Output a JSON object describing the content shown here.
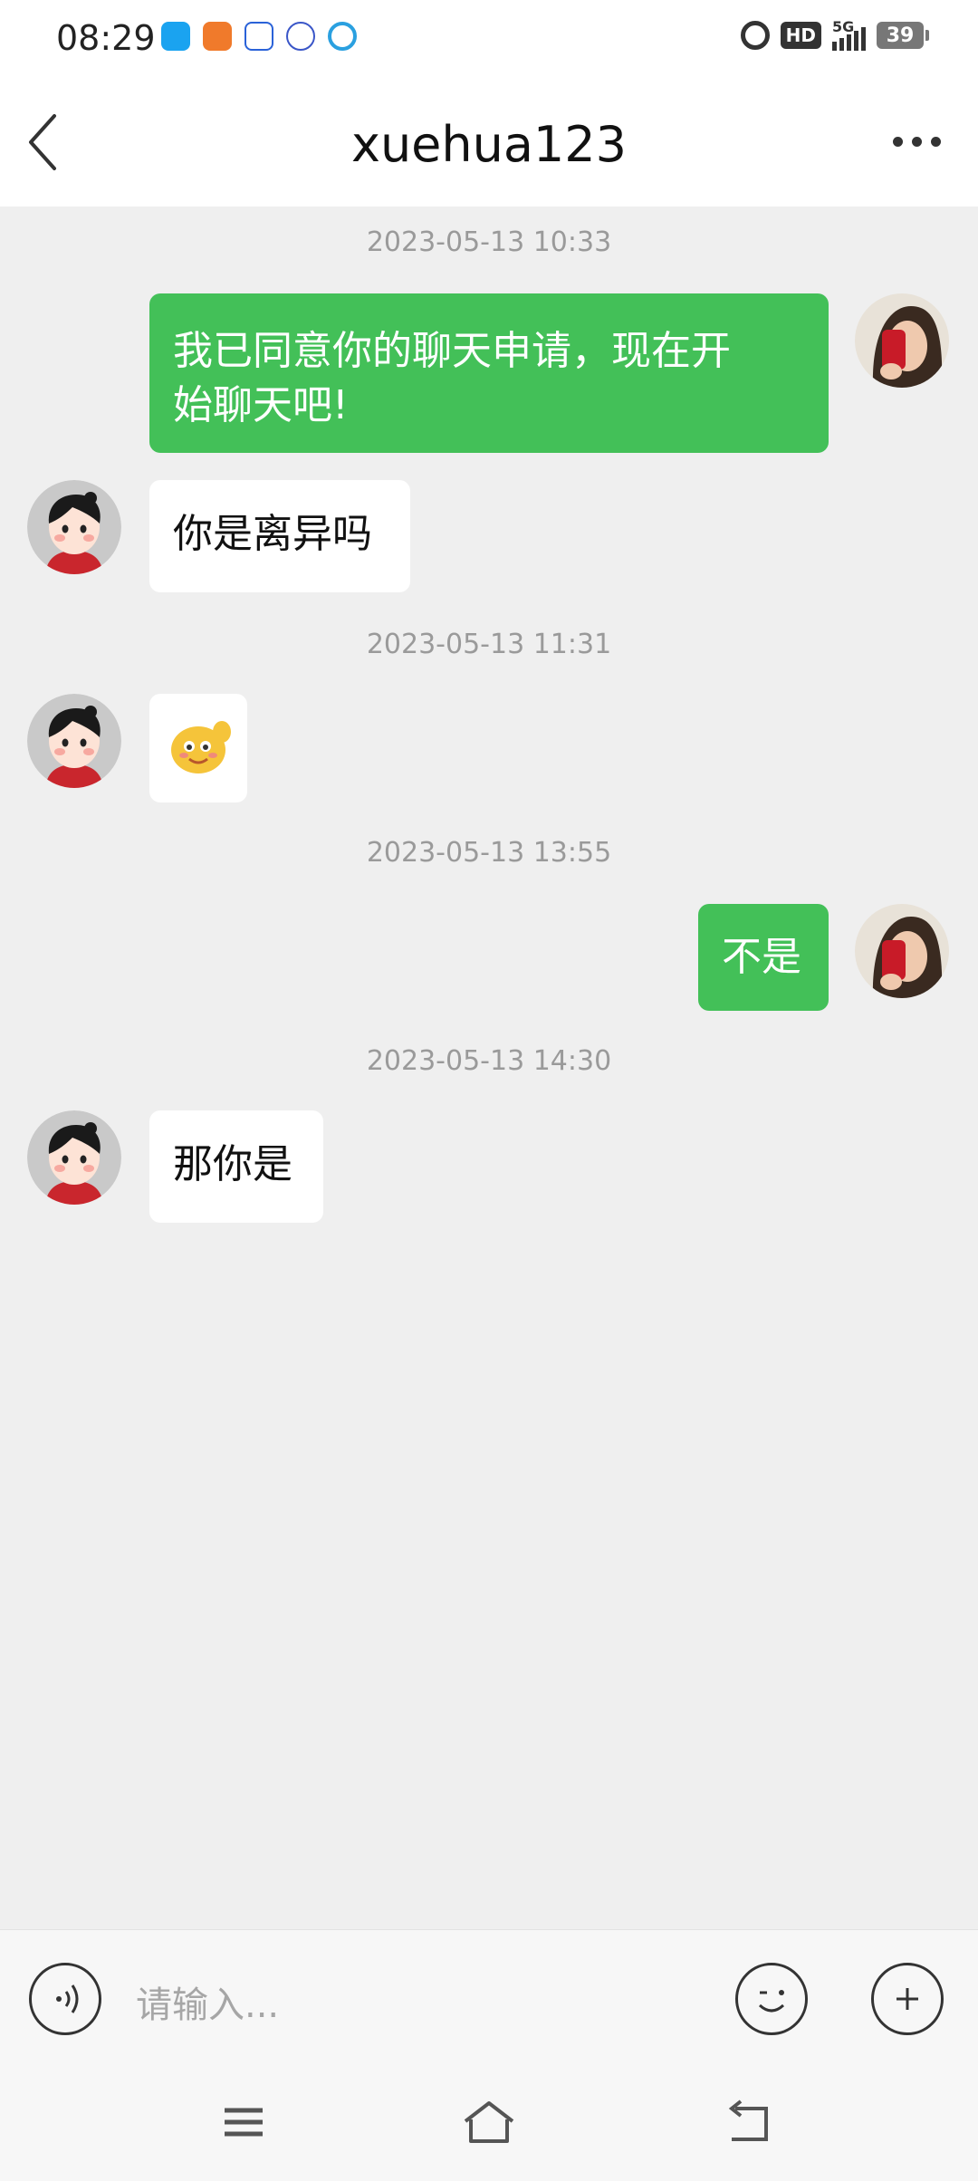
{
  "status_bar": {
    "time": "08:29",
    "network": "5G",
    "hd": "HD",
    "battery": "39"
  },
  "header": {
    "title": "xuehua123",
    "back_icon": "chevron-left-icon",
    "more_icon": "more-dots-icon"
  },
  "messages": [
    {
      "type": "timestamp",
      "text": "2023-05-13 10:33"
    },
    {
      "type": "message",
      "from": "me",
      "text": "我已同意你的聊天申请，现在开始聊天吧!",
      "line1": "我已同意你的聊天申请，现在开",
      "line2": "始聊天吧!"
    },
    {
      "type": "message",
      "from": "them",
      "text": "你是离异吗"
    },
    {
      "type": "timestamp",
      "text": "2023-05-13 11:31"
    },
    {
      "type": "message",
      "from": "them",
      "sticker": "emoji-sticker"
    },
    {
      "type": "timestamp",
      "text": "2023-05-13 13:55"
    },
    {
      "type": "message",
      "from": "me",
      "text": "不是"
    },
    {
      "type": "timestamp",
      "text": "2023-05-13 14:30"
    },
    {
      "type": "message",
      "from": "them",
      "text": "那你是"
    }
  ],
  "input": {
    "placeholder": "请输入..."
  },
  "colors": {
    "my_bubble": "#43c058",
    "chat_background": "#efefef"
  }
}
